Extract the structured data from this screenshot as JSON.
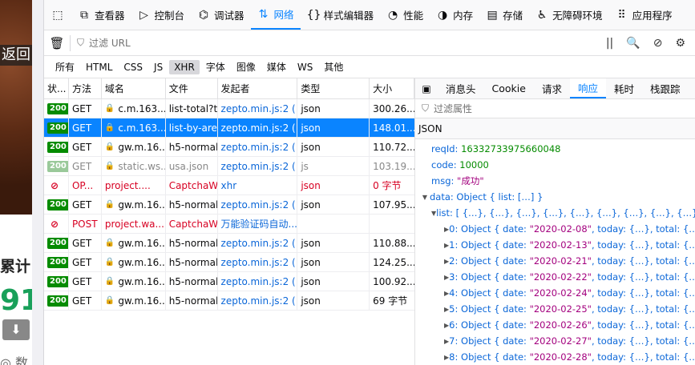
{
  "page": {
    "back_label": "返回",
    "text1": "累计",
    "big_number": "91",
    "text2": "◎ 数"
  },
  "toolbar": {
    "tabs": [
      {
        "label": "查看器",
        "icon": "inspector-icon"
      },
      {
        "label": "控制台",
        "icon": "console-icon"
      },
      {
        "label": "调试器",
        "icon": "debugger-icon"
      },
      {
        "label": "网络",
        "icon": "network-icon"
      },
      {
        "label": "样式编辑器",
        "icon": "style-editor-icon"
      },
      {
        "label": "性能",
        "icon": "performance-icon"
      },
      {
        "label": "内存",
        "icon": "memory-icon"
      },
      {
        "label": "存储",
        "icon": "storage-icon"
      },
      {
        "label": "无障碍环境",
        "icon": "accessibility-icon"
      },
      {
        "label": "应用程序",
        "icon": "application-icon"
      }
    ],
    "active": "网络"
  },
  "filter": {
    "placeholder": "过滤 URL",
    "pause": "||"
  },
  "types": [
    "所有",
    "HTML",
    "CSS",
    "JS",
    "XHR",
    "字体",
    "图像",
    "媒体",
    "WS",
    "其他"
  ],
  "active_type": "XHR",
  "columns": {
    "status": "状...",
    "method": "方法",
    "domain": "域名",
    "file": "文件",
    "initiator": "发起者",
    "type": "类型",
    "size": "大小"
  },
  "requests": [
    {
      "status": "200",
      "method": "GET",
      "domain": "c.m.163....",
      "file": "list-total?t=",
      "initiator": "zepto.min.js:2 (...",
      "type": "json",
      "size": "300.26..."
    },
    {
      "status": "200",
      "method": "GET",
      "domain": "c.m.163....",
      "file": "list-by-area",
      "initiator": "zepto.min.js:2 (...",
      "type": "json",
      "size": "148.01...",
      "selected": true
    },
    {
      "status": "200",
      "method": "GET",
      "domain": "gw.m.16...",
      "file": "h5-normal-",
      "initiator": "zepto.min.js:2 (...",
      "type": "json",
      "size": "110.72..."
    },
    {
      "status": "200",
      "method": "GET",
      "domain": "static.ws...",
      "file": "usa.json",
      "initiator": "zepto.min.js:2 (...",
      "type": "js",
      "size": "103.19...",
      "faded": true
    },
    {
      "status": "",
      "method": "OP...",
      "domain": "project....",
      "file": "CaptchaWr",
      "initiator": "xhr",
      "type": "json",
      "size": "0 字节",
      "blocked": true
    },
    {
      "status": "200",
      "method": "GET",
      "domain": "gw.m.16...",
      "file": "h5-normal-",
      "initiator": "zepto.min.js:2 (...",
      "type": "json",
      "size": "107.95..."
    },
    {
      "status": "",
      "method": "POST",
      "domain": "project.wa...",
      "file": "CaptchaWr",
      "initiator": "万能验证码自动...",
      "type": "",
      "size": "",
      "blocked": true
    },
    {
      "status": "200",
      "method": "GET",
      "domain": "gw.m.16...",
      "file": "h5-normal-",
      "initiator": "zepto.min.js:2 (...",
      "type": "json",
      "size": "110.88..."
    },
    {
      "status": "200",
      "method": "GET",
      "domain": "gw.m.16...",
      "file": "h5-normal-",
      "initiator": "zepto.min.js:2 (...",
      "type": "json",
      "size": "124.25..."
    },
    {
      "status": "200",
      "method": "GET",
      "domain": "gw.m.16...",
      "file": "h5-normal-",
      "initiator": "zepto.min.js:2 (...",
      "type": "json",
      "size": "100.92..."
    },
    {
      "status": "200",
      "method": "GET",
      "domain": "gw.m.16...",
      "file": "h5-normal-",
      "initiator": "zepto.min.js:2 (...",
      "type": "json",
      "size": "69 字节"
    }
  ],
  "panel": {
    "tabs": [
      "消息头",
      "Cookie",
      "请求",
      "响应",
      "耗时",
      "栈跟踪"
    ],
    "active": "响应",
    "filter_placeholder": "过滤属性",
    "json_label": "JSON",
    "tree": {
      "reqId_key": "reqId:",
      "reqId_val": "16332733975660048",
      "code_key": "code:",
      "code_val": "10000",
      "msg_key": "msg:",
      "msg_val": "\"成功\"",
      "data_line": "data: Object { list: […] }",
      "list_line": "list: [ {…}, {…}, {…}, {…}, {…}, {…}, {…}, {…}, {…}, … ]",
      "items": [
        {
          "idx": "0:",
          "date": "\"2020-02-08\""
        },
        {
          "idx": "1:",
          "date": "\"2020-02-13\""
        },
        {
          "idx": "2:",
          "date": "\"2020-02-21\""
        },
        {
          "idx": "3:",
          "date": "\"2020-02-22\""
        },
        {
          "idx": "4:",
          "date": "\"2020-02-24\""
        },
        {
          "idx": "5:",
          "date": "\"2020-02-25\""
        },
        {
          "idx": "6:",
          "date": "\"2020-02-26\""
        },
        {
          "idx": "7:",
          "date": "\"2020-02-27\""
        },
        {
          "idx": "8:",
          "date": "\"2020-02-28\""
        }
      ],
      "item_prefix": "Object { date:",
      "item_suffix": ", today: {…}, total: {…}, … }"
    }
  }
}
